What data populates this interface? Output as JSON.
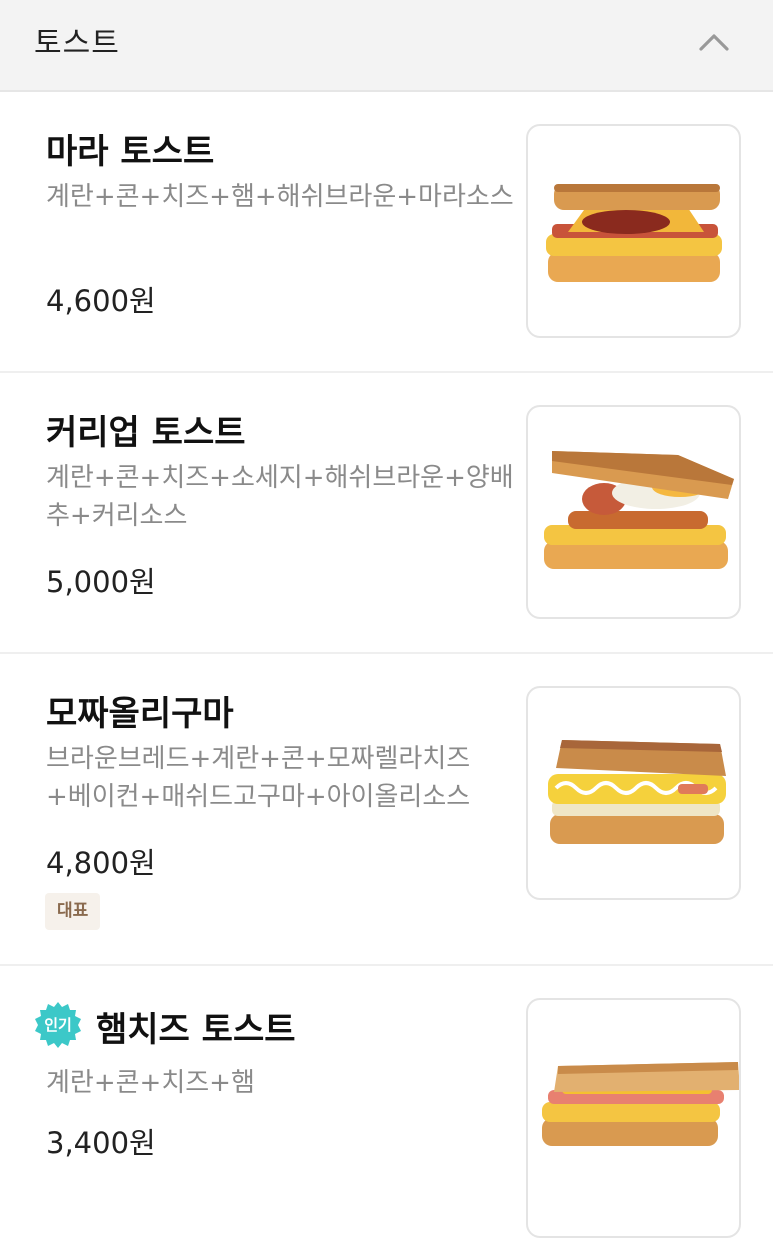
{
  "category": {
    "title": "토스트"
  },
  "items": [
    {
      "name": "마라 토스트",
      "description": "계란+콘+치즈+햄+해쉬브라운+마라소스",
      "price": "4,600원"
    },
    {
      "name": "커리업 토스트",
      "description": "계란+콘+치즈+소세지+해쉬브라운+양배추+커리소스",
      "price": "5,000원"
    },
    {
      "name": "모짜올리구마",
      "description": "브라운브레드+계란+콘+모짜렐라치즈+베이컨+매쉬드고구마+아이올리소스",
      "price": "4,800원",
      "tag": "대표"
    },
    {
      "name": "햄치즈 토스트",
      "description": "계란+콘+치즈+햄",
      "price": "3,400원",
      "badge": "인기"
    }
  ],
  "colors": {
    "popular_badge": "#3cc8c8",
    "tag_background": "#f6f1eb",
    "tag_text": "#8a6a4e"
  },
  "icons": {
    "collapse": "chevron-up-icon",
    "popular": "popular-badge-icon"
  }
}
